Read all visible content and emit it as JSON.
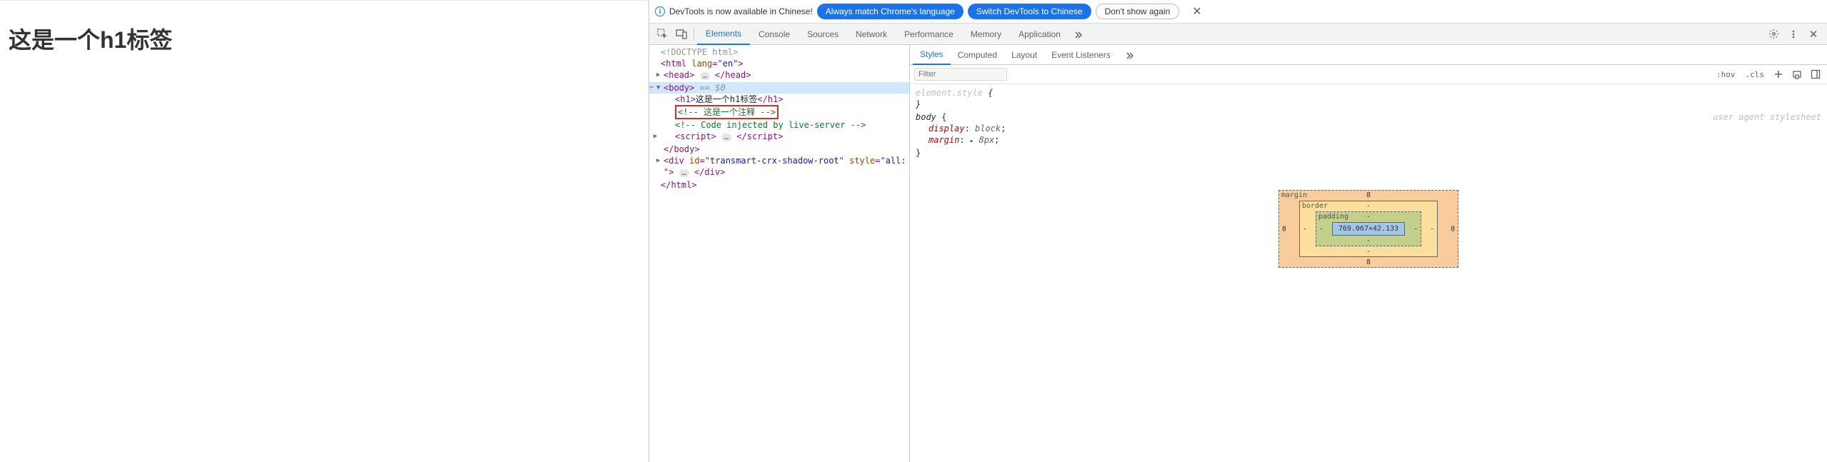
{
  "page": {
    "h1": "这是一个h1标签"
  },
  "banner": {
    "message": "DevTools is now available in Chinese!",
    "btn_always": "Always match Chrome's language",
    "btn_switch": "Switch DevTools to Chinese",
    "btn_dont": "Don't show again"
  },
  "tabs": {
    "elements": "Elements",
    "console": "Console",
    "sources": "Sources",
    "network": "Network",
    "performance": "Performance",
    "memory": "Memory",
    "application": "Application"
  },
  "dom": {
    "doctype": "<!DOCTYPE html>",
    "html_open": "<html lang=\"en\">",
    "head_open": "<head>",
    "head_close": "</head>",
    "body_open": "<body>",
    "body_sel": " == $0",
    "h1_open": "<h1>",
    "h1_text": "这是一个h1标签",
    "h1_close": "</h1>",
    "comment1": "<!-- 这是一个注释 -->",
    "comment2": "<!-- Code injected by live-server -->",
    "script_open": "<script>",
    "script_close": "</script>",
    "body_close": "</body>",
    "div_open_a": "<div id=\"",
    "div_id": "transmart-crx-shadow-root",
    "div_open_b": "\" style=\"",
    "div_style": "all: initial;",
    "div_open_c": "\">",
    "div_close": "</div>",
    "html_close": "</html>",
    "ellipsis": "…"
  },
  "styles": {
    "tabs": {
      "styles": "Styles",
      "computed": "Computed",
      "layout": "Layout",
      "event": "Event Listeners"
    },
    "filter_placeholder": "Filter",
    "hov": ":hov",
    "cls": ".cls",
    "rule1_sel": "element.style",
    "rule2_sel": "body",
    "rule2_origin": "user agent stylesheet",
    "rule2_p1_name": "display",
    "rule2_p1_val": "block",
    "rule2_p2_name": "margin",
    "rule2_p2_val": "8px",
    "brace_o": "{",
    "brace_c": "}",
    "tri": "▸"
  },
  "box_model": {
    "margin_label": "margin",
    "border_label": "border",
    "padding_label": "padding",
    "margin_t": "8",
    "margin_r": "8",
    "margin_b": "8",
    "margin_l": "8",
    "border_t": "-",
    "border_r": "-",
    "border_b": "-",
    "border_l": "-",
    "padding_t": "-",
    "padding_r": "-",
    "padding_b": "-",
    "padding_l": "-",
    "content": "769.067×42.133"
  }
}
